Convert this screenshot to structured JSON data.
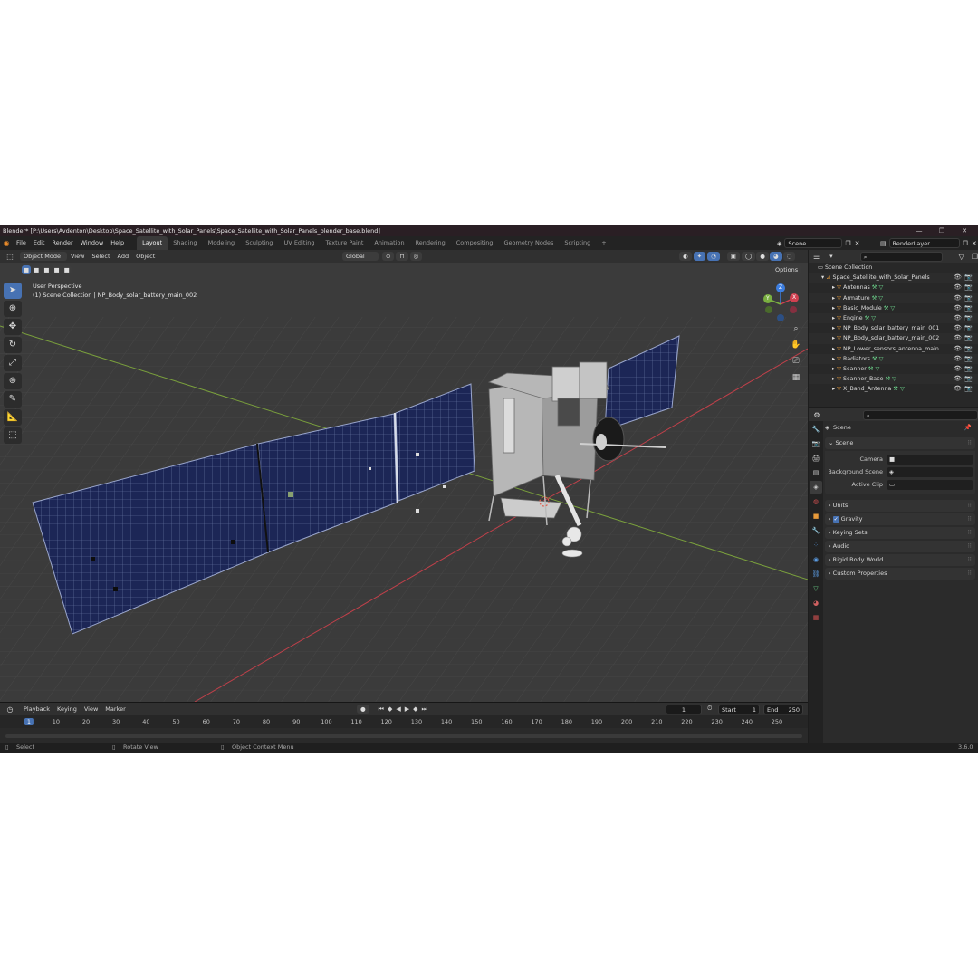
{
  "window": {
    "title": "Blender* [P:\\Users\\Avdenton\\Desktop\\Space_Satellite_with_Solar_Panels\\Space_Satellite_with_Solar_Panels_blender_base.blend]",
    "minimize": "—",
    "maximize": "❐",
    "close": "✕"
  },
  "menu": {
    "items": [
      "File",
      "Edit",
      "Render",
      "Window",
      "Help"
    ],
    "workspaces": [
      "Layout",
      "Shading",
      "Modeling",
      "Sculpting",
      "UV Editing",
      "Texture Paint",
      "Animation",
      "Rendering",
      "Compositing",
      "Geometry Nodes",
      "Scripting"
    ],
    "active_workspace": "Layout",
    "add_tab": "+",
    "scene_value": "Scene",
    "view_layer_value": "RenderLayer"
  },
  "viewport_header": {
    "mode": "Object Mode",
    "items": [
      "View",
      "Select",
      "Add",
      "Object"
    ],
    "transform_orientation": "Global",
    "options": "Options"
  },
  "viewport": {
    "view_name": "User Perspective",
    "collection_info": "(1) Scene Collection | NP_Body_solar_battery_main_002",
    "gizmo_axes": [
      "X",
      "Y",
      "Z"
    ],
    "nav_icons": [
      "zoom-icon",
      "hand-icon",
      "camera-icon",
      "grid-icon"
    ]
  },
  "timeline": {
    "menus": [
      "Playback",
      "Keying",
      "View",
      "Marker"
    ],
    "current_frame": "1",
    "start_label": "Start",
    "start_value": "1",
    "end_label": "End",
    "end_value": "250",
    "ticks": [
      "1",
      "10",
      "20",
      "30",
      "40",
      "50",
      "60",
      "70",
      "80",
      "90",
      "100",
      "110",
      "120",
      "130",
      "140",
      "150",
      "160",
      "170",
      "180",
      "190",
      "200",
      "210",
      "220",
      "230",
      "240",
      "250"
    ]
  },
  "status": {
    "select": "Select",
    "rotate": "Rotate View",
    "context": "Object Context Menu",
    "version": "3.6.0"
  },
  "outliner": {
    "root": "Scene Collection",
    "collection": "Space_Satellite_with_Solar_Panels",
    "objects": [
      "Antennas",
      "Armature",
      "Basic_Module",
      "Engine",
      "NP_Body_solar_battery_main_001",
      "NP_Body_solar_battery_main_002",
      "NP_Lower_sensors_antenna_main",
      "Radiators",
      "Scanner",
      "Scanner_Bace",
      "X_Band_Antenna"
    ]
  },
  "properties": {
    "context": "Scene",
    "section": "Scene",
    "camera_label": "Camera",
    "background_label": "Background Scene",
    "active_clip_label": "Active Clip",
    "panels": [
      "Units",
      "Gravity",
      "Keying Sets",
      "Audio",
      "Rigid Body World",
      "Custom Properties"
    ]
  },
  "colors": {
    "accent": "#4772b3",
    "panel_blue": "#1e2a5a",
    "x_axis": "#c0404a",
    "y_axis": "#7aa03c"
  }
}
